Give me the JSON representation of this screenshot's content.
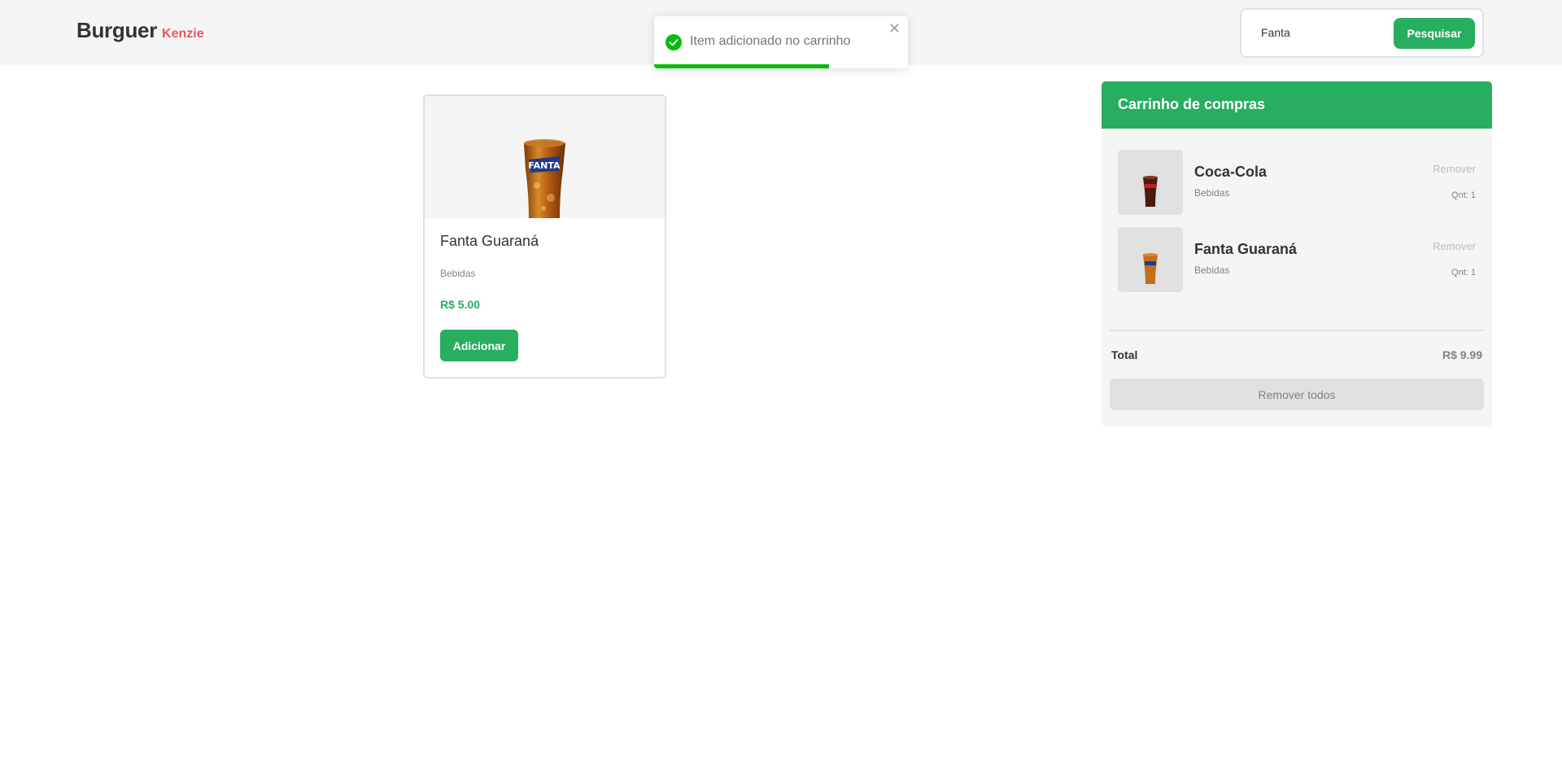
{
  "header": {
    "logo_main": "Burguer",
    "logo_sub": "Kenzie",
    "search": {
      "value": "Fanta",
      "button_label": "Pesquisar"
    }
  },
  "toast": {
    "message": "Item adicionado no carrinho",
    "close_icon": "close-icon",
    "status_icon": "check-circle-icon",
    "progress": 0.69,
    "color": "#07bc0c"
  },
  "products": [
    {
      "name": "Fanta Guaraná",
      "category": "Bebidas",
      "price": "R$ 5.00",
      "button_label": "Adicionar"
    }
  ],
  "cart": {
    "title": "Carrinho de compras",
    "items": [
      {
        "name": "Coca-Cola",
        "category": "Bebidas",
        "remove_label": "Remover",
        "qty": "Qnt: 1"
      },
      {
        "name": "Fanta Guaraná",
        "category": "Bebidas",
        "remove_label": "Remover",
        "qty": "Qnt: 1"
      }
    ],
    "total_label": "Total",
    "total_value": "R$ 9.99",
    "remove_all_label": "Remover todos"
  },
  "colors": {
    "primary": "#27ae60",
    "brand_accent": "#eb5757",
    "header_bg": "#f5f5f5"
  }
}
